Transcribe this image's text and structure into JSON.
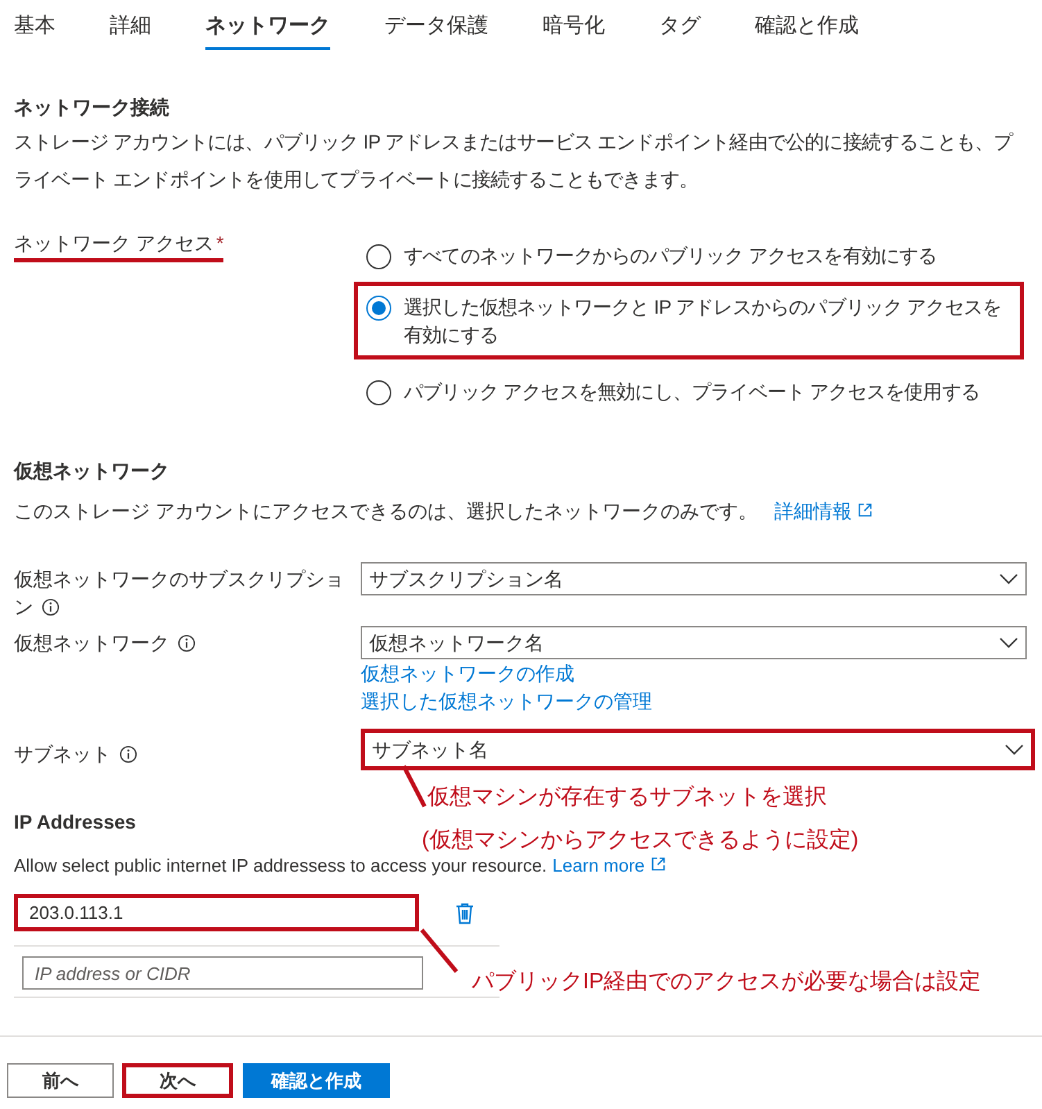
{
  "tabs": [
    {
      "label": "基本",
      "selected": false
    },
    {
      "label": "詳細",
      "selected": false
    },
    {
      "label": "ネットワーク",
      "selected": true
    },
    {
      "label": "データ保護",
      "selected": false
    },
    {
      "label": "暗号化",
      "selected": false
    },
    {
      "label": "タグ",
      "selected": false
    },
    {
      "label": "確認と作成",
      "selected": false
    }
  ],
  "network_connectivity": {
    "heading": "ネットワーク接続",
    "description": "ストレージ アカウントには、パブリック IP アドレスまたはサービス エンドポイント経由で公的に接続することも、プライベート エンドポイントを使用してプライベートに接続することもできます。",
    "access_label": "ネットワーク アクセス",
    "required_mark": "*",
    "access_label_underlined": true,
    "options": [
      {
        "label": "すべてのネットワークからのパブリック アクセスを有効にする",
        "selected": false,
        "highlighted": false
      },
      {
        "label": "選択した仮想ネットワークと IP アドレスからのパブリック アクセスを有効にする",
        "selected": true,
        "highlighted": true
      },
      {
        "label": "パブリック アクセスを無効にし、プライベート アクセスを使用する",
        "selected": false,
        "highlighted": false
      }
    ]
  },
  "virtual_networks": {
    "heading": "仮想ネットワーク",
    "description": "このストレージ アカウントにアクセスできるのは、選択したネットワークのみです。",
    "link": "詳細情報",
    "fields": [
      {
        "label": "仮想ネットワークのサブスクリプション",
        "value": "サブスクリプション名",
        "highlighted": false
      },
      {
        "label": "仮想ネットワーク",
        "value": "仮想ネットワーク名",
        "highlighted": false,
        "links": [
          "仮想ネットワークの作成",
          "選択した仮想ネットワークの管理"
        ]
      },
      {
        "label": "サブネット",
        "value": "サブネット名",
        "highlighted": true
      }
    ]
  },
  "ip_addresses": {
    "heading": "IP Addresses",
    "description": "Allow select public internet IP addressess to access your resource.",
    "link": "Learn more",
    "entries": [
      {
        "value": "203.0.113.1",
        "highlighted": true
      }
    ],
    "new_entry": {
      "placeholder": "IP address or CIDR"
    }
  },
  "annotations": [
    {
      "text": "仮想マシンが存在するサブネットを選択"
    },
    {
      "text": "(仮想マシンからアクセスできるように設定)"
    },
    {
      "text": "パブリックIP経由でのアクセスが必要な場合は設定"
    }
  ],
  "buttons": [
    {
      "label": "前へ",
      "kind": "secondary",
      "highlighted": false
    },
    {
      "label": "次へ",
      "kind": "secondary",
      "highlighted": true
    },
    {
      "label": "確認と作成",
      "kind": "primary",
      "highlighted": false
    }
  ]
}
